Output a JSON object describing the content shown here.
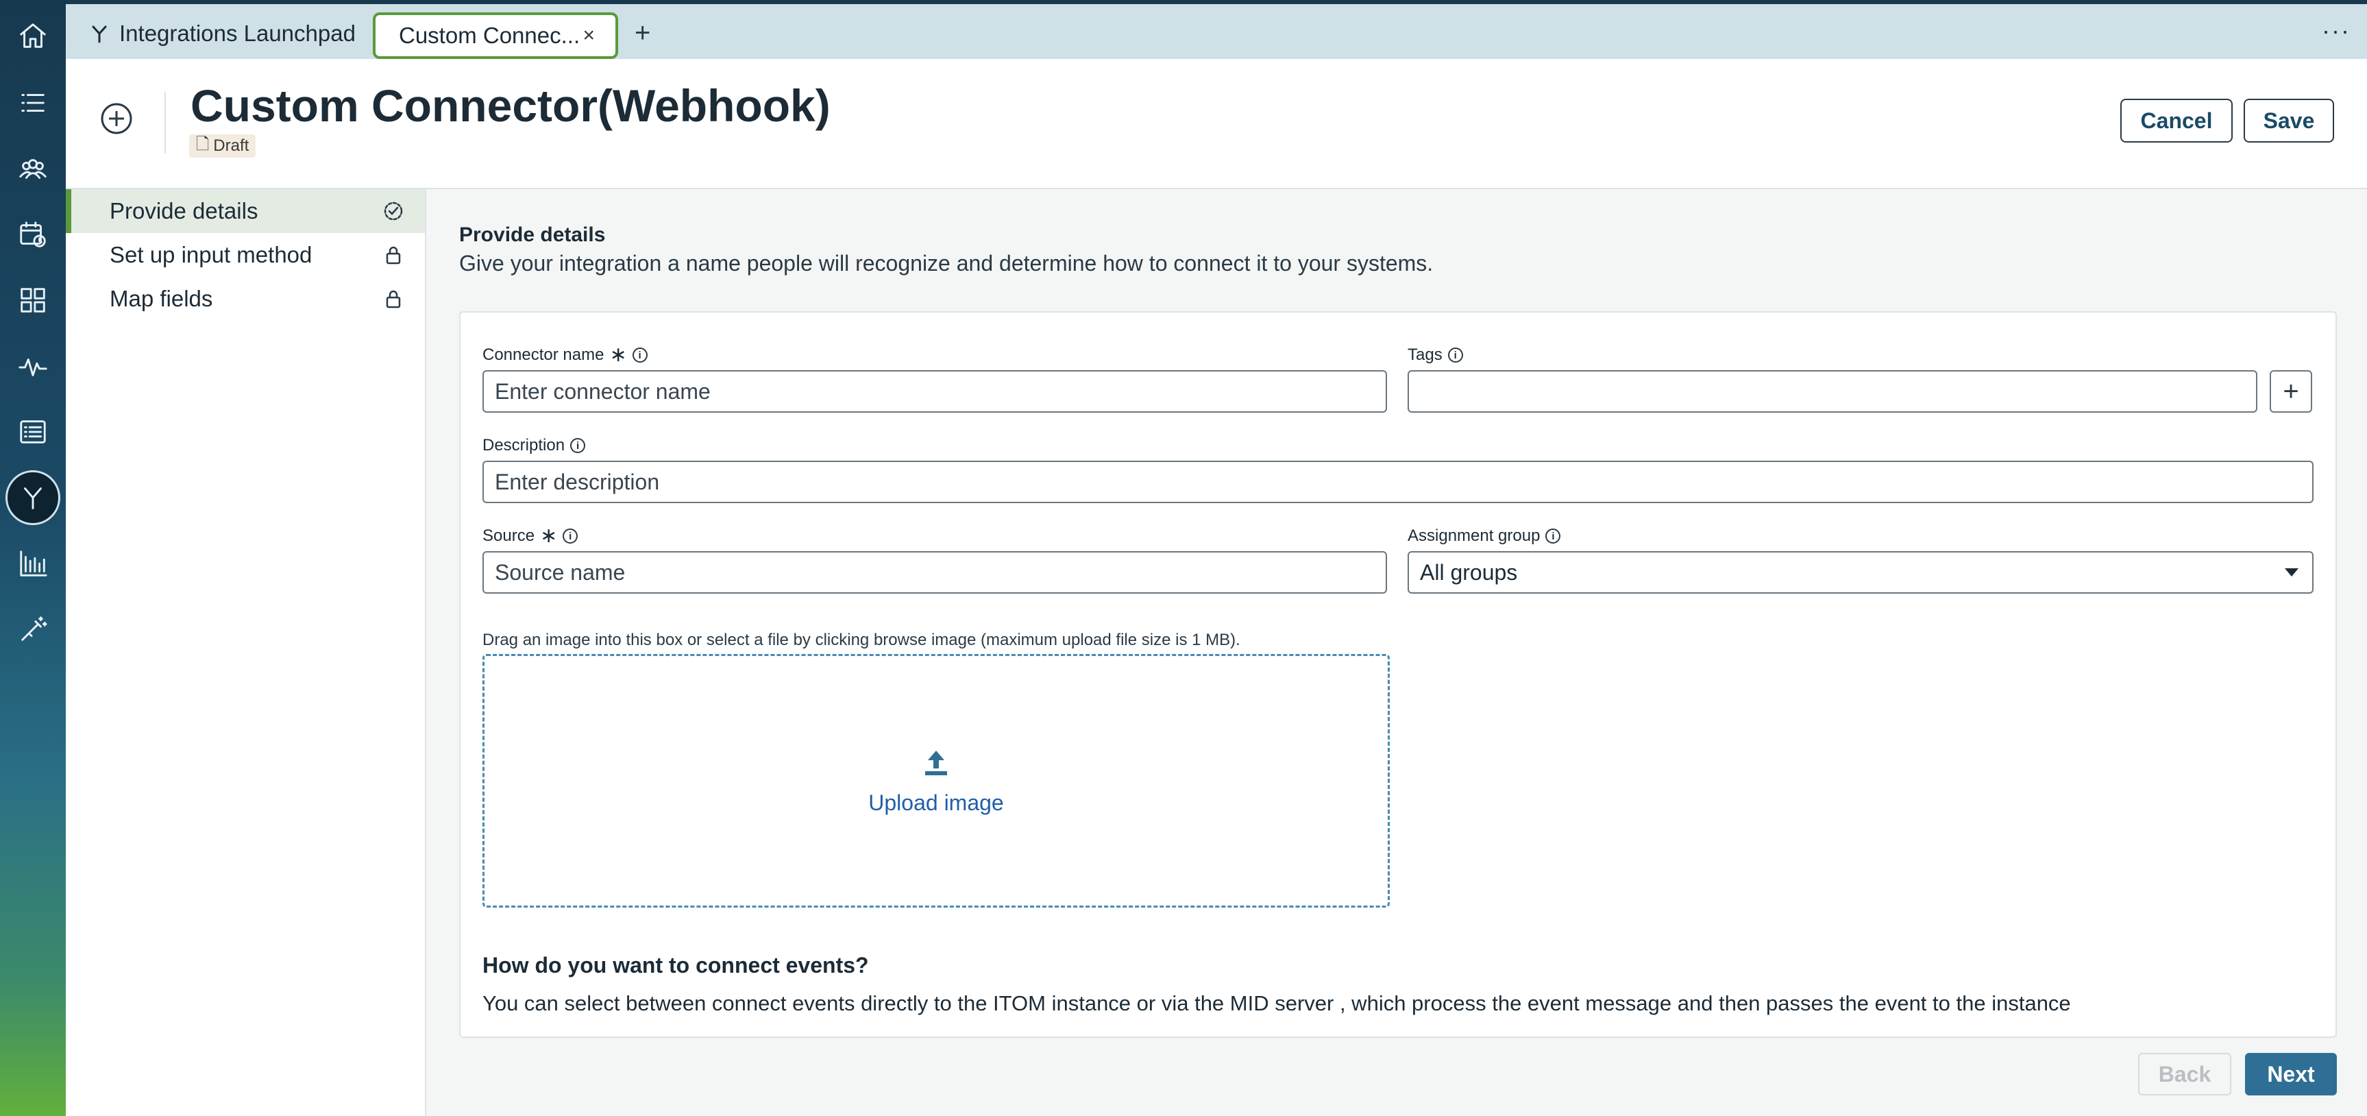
{
  "tabs": {
    "launchpad_label": "Integrations Launchpad",
    "active_label": "Custom Connec...",
    "close_glyph": "×",
    "add_glyph": "+",
    "more_glyph": "···"
  },
  "header": {
    "title": "Custom Connector(Webhook)",
    "status_badge": "Draft",
    "cancel_label": "Cancel",
    "save_label": "Save"
  },
  "steps": [
    {
      "label": "Provide details",
      "state": "active"
    },
    {
      "label": "Set up input method",
      "state": "locked"
    },
    {
      "label": "Map fields",
      "state": "locked"
    }
  ],
  "section": {
    "title": "Provide details",
    "description": "Give your integration a name people will recognize and determine how to connect it to your systems."
  },
  "form": {
    "connector_name_label": "Connector name",
    "connector_name_placeholder": "Enter connector name",
    "tags_label": "Tags",
    "tags_add_glyph": "+",
    "description_label": "Description",
    "description_placeholder": "Enter description",
    "source_label": "Source",
    "source_placeholder": "Source name",
    "assignment_group_label": "Assignment group",
    "assignment_group_value": "All groups",
    "required_glyph": "∗",
    "info_glyph": "i"
  },
  "upload": {
    "hint": "Drag an image into this box or select a file by clicking browse image (maximum upload file size is 1 MB).",
    "label": "Upload image"
  },
  "connect": {
    "title": "How do you want to connect events?",
    "description": "You can select between connect events directly to the ITOM instance or via the MID server , which process the event message and then passes the event to the instance"
  },
  "footer": {
    "back_label": "Back",
    "next_label": "Next"
  },
  "colors": {
    "accent_green": "#5a9a3a",
    "primary_blue": "#2f6f96",
    "link_blue": "#1f5fa8"
  }
}
